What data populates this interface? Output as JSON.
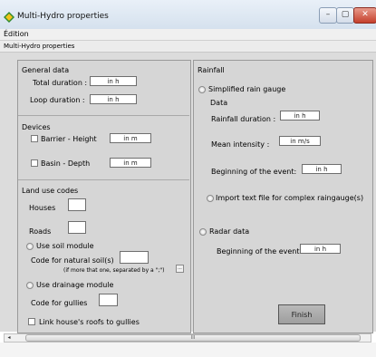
{
  "window": {
    "title": "Multi-Hydro properties",
    "minimize": "–",
    "maximize": "▢",
    "close": "✕"
  },
  "menu": {
    "edition": "Édition"
  },
  "tab": {
    "label": "Multi-Hydro properties"
  },
  "general": {
    "title": "General data",
    "total_duration_label": "Total duration :",
    "total_duration_unit": "in h",
    "loop_duration_label": "Loop duration :",
    "loop_duration_unit": "in h"
  },
  "devices": {
    "title": "Devices",
    "barrier_label": "Barrier - Height",
    "barrier_unit": "in m",
    "basin_label": "Basin - Depth",
    "basin_unit": "in m"
  },
  "landuse": {
    "title": "Land use codes",
    "houses_label": "Houses",
    "roads_label": "Roads",
    "soil_module_label": "Use soil module",
    "natural_soil_label": "Code for natural soil(s)",
    "separator_note": "(if more that one, separated by a \";\")",
    "dots": "...",
    "drainage_label": "Use drainage module",
    "gullies_label": "Code for gullies",
    "link_label": "Link house's roofs to gullies"
  },
  "rainfall": {
    "title": "Rainfall",
    "simplified_label": "Simplified rain gauge",
    "data_label": "Data",
    "rain_duration_label": "Rainfall duration :",
    "rain_duration_unit": "in h",
    "mean_intensity_label": "Mean intensity :",
    "mean_intensity_unit": "in m/s",
    "beginning_label": "Beginning of the event:",
    "beginning_unit": "in h",
    "import_label": "Import text file for complex raingauge(s)",
    "radar_label": "Radar data",
    "radar_beginning_label": "Beginning of the event:",
    "radar_beginning_unit": "in h",
    "finish_label": "Finish"
  },
  "scrollbar": {
    "left_arrow": "◂",
    "thumb_grip": "III"
  }
}
